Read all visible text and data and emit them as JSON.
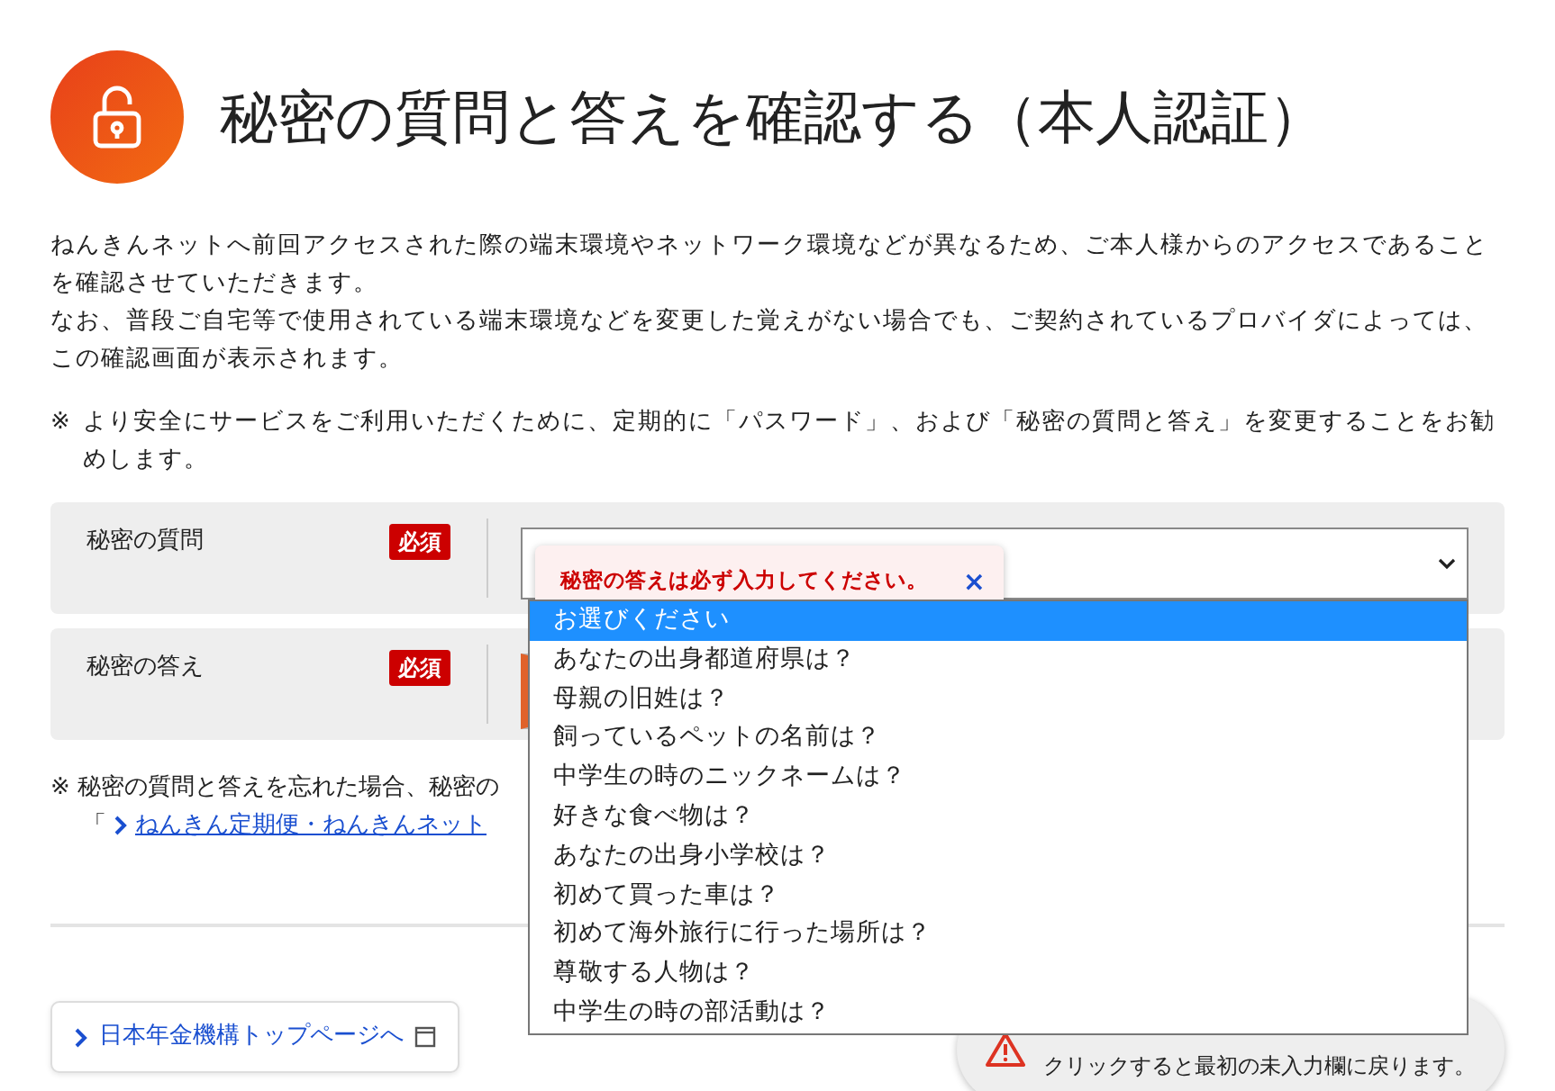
{
  "header": {
    "title": "秘密の質問と答えを確認する（本人認証）"
  },
  "intro": [
    "ねんきんネットへ前回アクセスされた際の端末環境やネットワーク環境などが異なるため、ご本人様からのアクセスであることを確認させていただきます。",
    "なお、普段ご自宅等で使用されている端末環境などを変更した覚えがない場合でも、ご契約されているプロバイダによっては、この確認画面が表示されます。"
  ],
  "note": {
    "mark": "※",
    "text": "より安全にサービスをご利用いただくために、定期的に「パスワード」、および「秘密の質問と答え」を変更することをお勧めします。"
  },
  "form": {
    "rows": [
      {
        "label": "秘密の質問",
        "badge": "必須",
        "kind": "select",
        "invalid": false
      },
      {
        "label": "秘密の答え",
        "badge": "必須",
        "kind": "text",
        "invalid": true
      }
    ]
  },
  "error_tooltip": {
    "message": "秘密の答えは必ず入力してください。",
    "close": "×"
  },
  "dropdown": {
    "options": [
      {
        "label": "お選びください",
        "selected": true
      },
      {
        "label": "あなたの出身都道府県は？",
        "selected": false
      },
      {
        "label": "母親の旧姓は？",
        "selected": false
      },
      {
        "label": "飼っているペットの名前は？",
        "selected": false
      },
      {
        "label": "中学生の時のニックネームは？",
        "selected": false
      },
      {
        "label": "好きな食べ物は？",
        "selected": false
      },
      {
        "label": "あなたの出身小学校は？",
        "selected": false
      },
      {
        "label": "初めて買った車は？",
        "selected": false
      },
      {
        "label": "初めて海外旅行に行った場所は？",
        "selected": false
      },
      {
        "label": "尊敬する人物は？",
        "selected": false
      },
      {
        "label": "中学生の時の部活動は？",
        "selected": false
      }
    ]
  },
  "forgot_note": {
    "text": "※ 秘密の質問と答えを忘れた場合、秘密の",
    "bracket": "「",
    "link": "ねんきん定期便・ねんきんネット"
  },
  "home_link": {
    "label": "日本年金機構トップページへ"
  },
  "toast": {
    "message": "クリックすると最初の未入力欄に戻ります。"
  }
}
